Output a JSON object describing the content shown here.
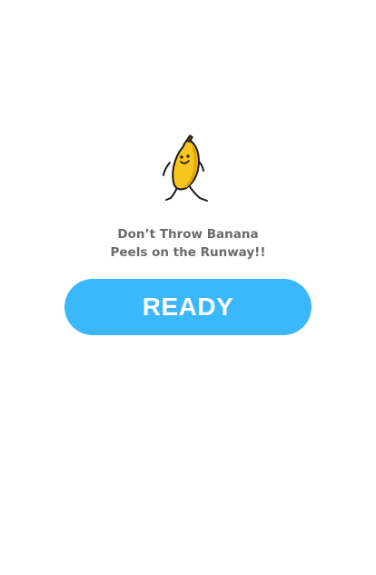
{
  "screen": {
    "background_color": "#ffffff"
  },
  "mascot": {
    "icon": "dancing-banana-icon",
    "colors": {
      "body": "#f7c51d",
      "outline": "#1a1a1a",
      "shade": "#e0a800"
    }
  },
  "message": {
    "line1": "Don’t Throw Banana",
    "line2": "Peels on the Runway!!",
    "color": "#6b6b6b"
  },
  "ready_button": {
    "label": "READY",
    "color": "#3bb7fb",
    "text_color": "#ffffff"
  }
}
